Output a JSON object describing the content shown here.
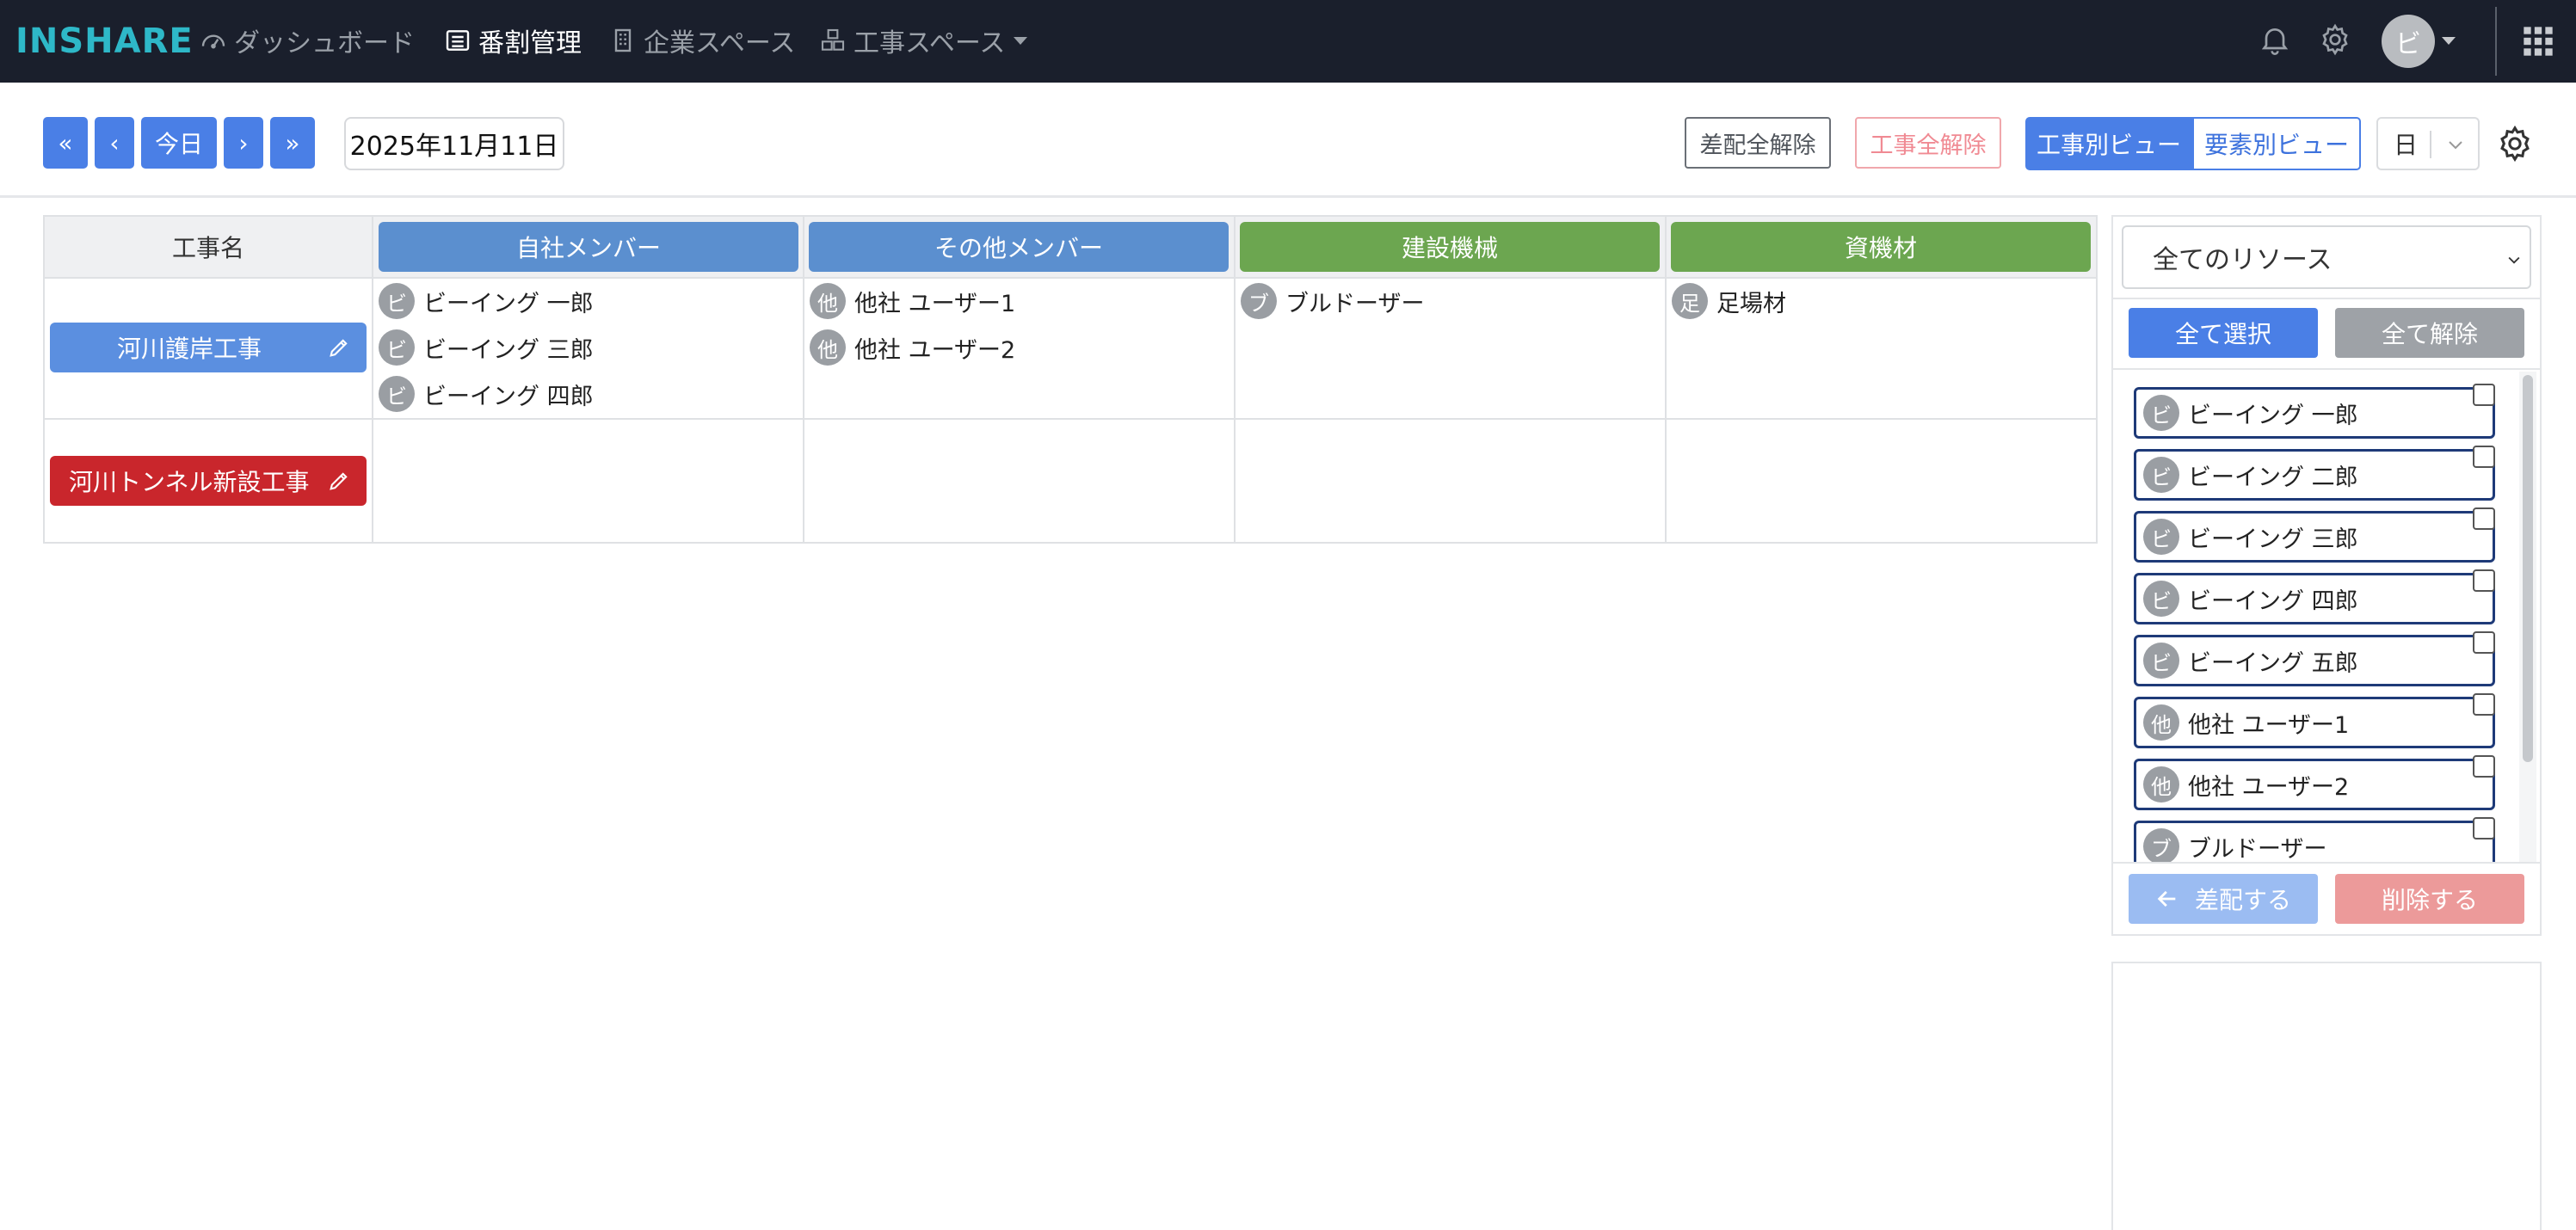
{
  "colors": {
    "navbar_bg": "#1a1f2c",
    "accent_blue": "#4a7fe6",
    "logo": "#2eb8c8",
    "project_red": "#c9262c",
    "header_green": "#6ca650",
    "header_blue": "#5b8fcf"
  },
  "navbar": {
    "logo": "INSHARE",
    "items": [
      {
        "label": "ダッシュボード",
        "icon": "speedometer-icon"
      },
      {
        "label": "番割管理",
        "icon": "list-icon"
      },
      {
        "label": "企業スペース",
        "icon": "building-icon"
      },
      {
        "label": "工事スペース",
        "icon": "boxes-icon"
      }
    ],
    "avatar": "ビ"
  },
  "toolbar": {
    "first_label": "«",
    "prev_label": "‹",
    "today_label": "今日",
    "next_label": "›",
    "last_label": "»",
    "date": "2025年11月11日",
    "clear_assign_label": "差配全解除",
    "clear_project_label": "工事全解除",
    "view_project_label": "工事別ビュー",
    "view_element_label": "要素別ビュー",
    "period": "日"
  },
  "table": {
    "name_header": "工事名",
    "columns": [
      {
        "label": "自社メンバー",
        "color": "#5b8fcf"
      },
      {
        "label": "その他メンバー",
        "color": "#5b8fcf"
      },
      {
        "label": "建設機械",
        "color": "#6ca650"
      },
      {
        "label": "資機材",
        "color": "#6ca650"
      }
    ],
    "projects": [
      {
        "name": "河川護岸工事",
        "color": "#5b8fe0",
        "own_members": [
          {
            "avatar": "ビ",
            "name": "ビーイング 一郎"
          },
          {
            "avatar": "ビ",
            "name": "ビーイング 三郎"
          },
          {
            "avatar": "ビ",
            "name": "ビーイング 四郎"
          }
        ],
        "other_members": [
          {
            "avatar": "他",
            "name": "他社 ユーザー1"
          },
          {
            "avatar": "他",
            "name": "他社 ユーザー2"
          }
        ],
        "machines": [
          {
            "avatar": "ブ",
            "name": "ブルドーザー"
          }
        ],
        "materials": [
          {
            "avatar": "足",
            "name": "足場材"
          }
        ]
      },
      {
        "name": "河川トンネル新設工事",
        "color": "#c9262c",
        "own_members": [],
        "other_members": [],
        "machines": [],
        "materials": []
      }
    ]
  },
  "panel": {
    "filter": "全てのリソース",
    "select_all_label": "全て選択",
    "deselect_all_label": "全て解除",
    "resources": [
      {
        "avatar": "ビ",
        "name": "ビーイング 一郎"
      },
      {
        "avatar": "ビ",
        "name": "ビーイング 二郎"
      },
      {
        "avatar": "ビ",
        "name": "ビーイング 三郎"
      },
      {
        "avatar": "ビ",
        "name": "ビーイング 四郎"
      },
      {
        "avatar": "ビ",
        "name": "ビーイング 五郎"
      },
      {
        "avatar": "他",
        "name": "他社 ユーザー1"
      },
      {
        "avatar": "他",
        "name": "他社 ユーザー2"
      },
      {
        "avatar": "ブ",
        "name": "ブルドーザー"
      }
    ],
    "assign_label": "差配する",
    "delete_label": "削除する"
  }
}
